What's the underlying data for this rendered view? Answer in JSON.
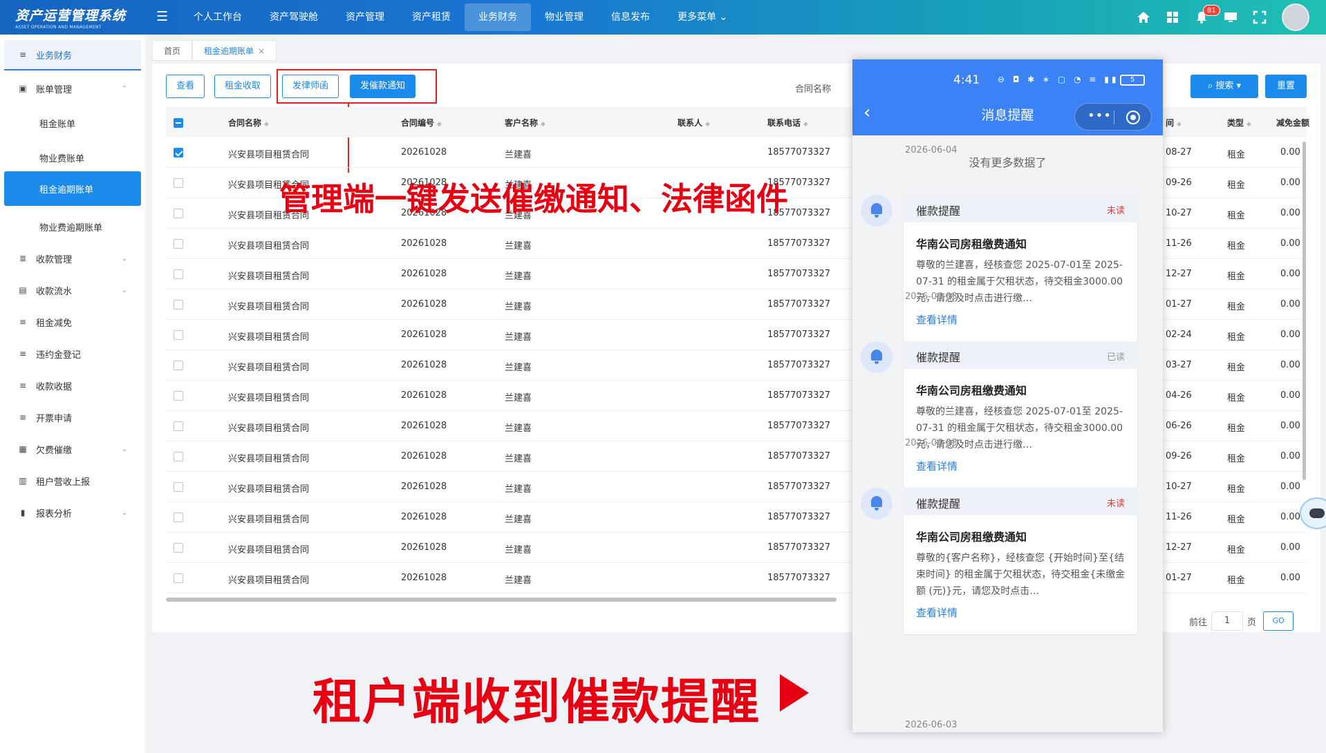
{
  "header": {
    "brand_title": "资产运营管理系统",
    "brand_sub": "ASSET OPERATION AND MANAGEMENT",
    "nav": [
      "个人工作台",
      "资产驾驶舱",
      "资产管理",
      "资产租赁",
      "业务财务",
      "物业管理",
      "信息发布",
      "更多菜单"
    ],
    "nav_more_arrow": "⌄",
    "notification_count": "81"
  },
  "sidebar": {
    "top": "业务财务",
    "items": [
      {
        "label": "账单管理",
        "arrow": "⌃"
      },
      {
        "label": "租金账单"
      },
      {
        "label": "物业费账单"
      },
      {
        "label": "租金逾期账单"
      },
      {
        "label": "物业费逾期账单"
      },
      {
        "label": "收款管理",
        "arrow": "⌄"
      },
      {
        "label": "收款流水",
        "arrow": "⌄"
      },
      {
        "label": "租金减免"
      },
      {
        "label": "违约金登记"
      },
      {
        "label": "收款收据"
      },
      {
        "label": "开票申请"
      },
      {
        "label": "欠费催缴",
        "arrow": "⌄"
      },
      {
        "label": "租户营收上报"
      },
      {
        "label": "报表分析",
        "arrow": "⌄"
      }
    ]
  },
  "tabs": {
    "home": "首页",
    "current": "租金逾期账单",
    "close": "×"
  },
  "toolbar": {
    "view": "查看",
    "collect": "租金收取",
    "lawyer": "发律师函",
    "notice": "发催款通知"
  },
  "search": {
    "label": "合同名称",
    "search_btn": "搜索",
    "reset_btn": "重置"
  },
  "annotations": {
    "top": "管理端一键发送催缴通知、法律函件",
    "bottom": "租户端收到催款提醒"
  },
  "table": {
    "headers": {
      "name": "合同名称",
      "code": "合同编号",
      "customer": "客户名称",
      "contact": "联系人",
      "phone": "联系电话",
      "tail": "间",
      "type": "类型",
      "reduce": "减免金额"
    },
    "rows": [
      {
        "name": "兴安县项目租赁合同",
        "code": "20261028",
        "customer": "兰建喜",
        "phone": "18577073327",
        "date": "08-27",
        "type": "租金",
        "amount": "0.00",
        "checked": true
      },
      {
        "name": "兴安县项目租赁合同",
        "code": "20261028",
        "customer": "兰建喜",
        "phone": "18577073327",
        "date": "09-26",
        "type": "租金",
        "amount": "0.00"
      },
      {
        "name": "兴安县项目租赁合同",
        "code": "20261028",
        "customer": "兰建喜",
        "phone": "18577073327",
        "date": "10-27",
        "type": "租金",
        "amount": "0.00"
      },
      {
        "name": "兴安县项目租赁合同",
        "code": "20261028",
        "customer": "兰建喜",
        "phone": "18577073327",
        "date": "11-26",
        "type": "租金",
        "amount": "0.00"
      },
      {
        "name": "兴安县项目租赁合同",
        "code": "20261028",
        "customer": "兰建喜",
        "phone": "18577073327",
        "date": "12-27",
        "type": "租金",
        "amount": "0.00"
      },
      {
        "name": "兴安县项目租赁合同",
        "code": "20261028",
        "customer": "兰建喜",
        "phone": "18577073327",
        "date": "01-27",
        "type": "租金",
        "amount": "0.00"
      },
      {
        "name": "兴安县项目租赁合同",
        "code": "20261028",
        "customer": "兰建喜",
        "phone": "18577073327",
        "date": "02-24",
        "type": "租金",
        "amount": "0.00"
      },
      {
        "name": "兴安县项目租赁合同",
        "code": "20261028",
        "customer": "兰建喜",
        "phone": "18577073327",
        "date": "03-27",
        "type": "租金",
        "amount": "0.00"
      },
      {
        "name": "兴安县项目租赁合同",
        "code": "20261028",
        "customer": "兰建喜",
        "phone": "18577073327",
        "date": "04-26",
        "type": "租金",
        "amount": "0.00"
      },
      {
        "name": "兴安县项目租赁合同",
        "code": "20261028",
        "customer": "兰建喜",
        "phone": "18577073327",
        "date": "06-26",
        "type": "租金",
        "amount": "0.00"
      },
      {
        "name": "兴安县项目租赁合同",
        "code": "20261028",
        "customer": "兰建喜",
        "phone": "18577073327",
        "date": "09-26",
        "type": "租金",
        "amount": "0.00"
      },
      {
        "name": "兴安县项目租赁合同",
        "code": "20261028",
        "customer": "兰建喜",
        "phone": "18577073327",
        "date": "10-27",
        "type": "租金",
        "amount": "0.00"
      },
      {
        "name": "兴安县项目租赁合同",
        "code": "20261028",
        "customer": "兰建喜",
        "phone": "18577073327",
        "date": "11-26",
        "type": "租金",
        "amount": "0.00"
      },
      {
        "name": "兴安县项目租赁合同",
        "code": "20261028",
        "customer": "兰建喜",
        "phone": "18577073327",
        "date": "12-27",
        "type": "租金",
        "amount": "0.00"
      },
      {
        "name": "兴安县项目租赁合同",
        "code": "20261028",
        "customer": "兰建喜",
        "phone": "18577073327",
        "date": "01-27",
        "type": "租金",
        "amount": "0.00"
      }
    ]
  },
  "pager": {
    "prefix": "前往",
    "page": "1",
    "suffix": "页",
    "go": "GO"
  },
  "phone": {
    "time": "4:41",
    "status_icons": "⊖ ◘ ✱ ∗ ▢ ◔ ≋ ▮▮",
    "battery": "5",
    "title": "消息提醒",
    "no_more": "没有更多数据了",
    "messages": [
      {
        "date": "2026-06-04",
        "head": "催款提醒",
        "status": "未读",
        "status_kind": "unread",
        "title": "华南公司房租缴费通知",
        "body": "尊敬的兰建喜，经核查您 2025-07-01至 2025-07-31 的租金属于欠租状态，待交租金3000.00元，请您及时点击进行缴…",
        "link": "查看详情"
      },
      {
        "date": "2026-06-03",
        "head": "催款提醒",
        "status": "已读",
        "status_kind": "read",
        "title": "华南公司房租缴费通知",
        "body": "尊敬的兰建喜，经核查您 2025-07-01至 2025-07-31 的租金属于欠租状态，待交租金3000.00元，请您及时点击进行缴…",
        "link": "查看详情"
      },
      {
        "date": "2026-06-03",
        "head": "催款提醒",
        "status": "未读",
        "status_kind": "unread",
        "title": "华南公司房租缴费通知",
        "body": "尊敬的{客户名称}，经核查您 {开始时间}至{结束时间} 的租金属于欠租状态，待交租金{未缴金额 (元)}元，请您及时点击…",
        "link": "查看详情"
      }
    ],
    "tail_date": "2026-06-03"
  }
}
